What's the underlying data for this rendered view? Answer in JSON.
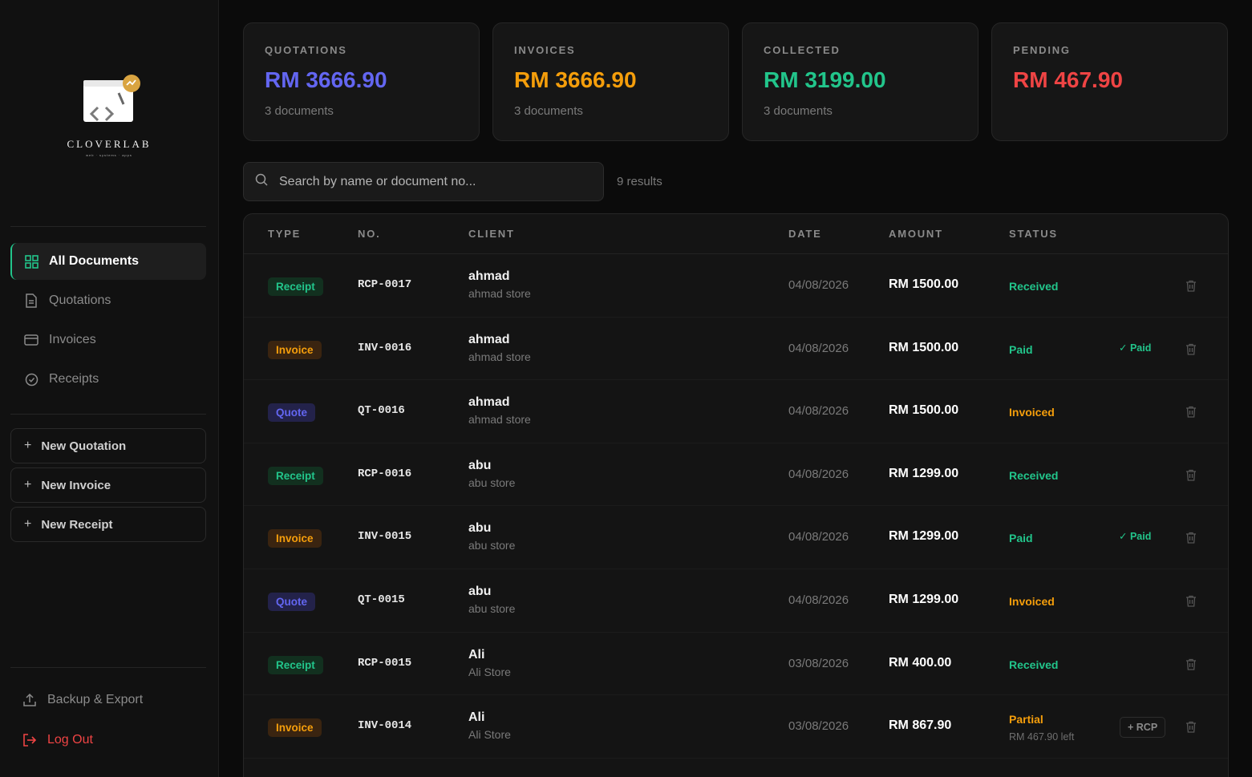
{
  "brand": {
    "name": "CLOVERLAB",
    "tagline": "web · systems · apps"
  },
  "nav": [
    {
      "label": "All Documents",
      "icon": "grid-icon",
      "active": true
    },
    {
      "label": "Quotations",
      "icon": "document-icon",
      "active": false
    },
    {
      "label": "Invoices",
      "icon": "card-icon",
      "active": false
    },
    {
      "label": "Receipts",
      "icon": "check-circle-icon",
      "active": false
    }
  ],
  "new_buttons": [
    {
      "label": "New Quotation"
    },
    {
      "label": "New Invoice"
    },
    {
      "label": "New Receipt"
    }
  ],
  "bottom": {
    "backup": "Backup & Export",
    "logout": "Log Out"
  },
  "summary": [
    {
      "label": "QUOTATIONS",
      "value": "RM 3666.90",
      "sub": "3 documents",
      "color": "#6366f1"
    },
    {
      "label": "INVOICES",
      "value": "RM 3666.90",
      "sub": "3 documents",
      "color": "#f59e0b"
    },
    {
      "label": "COLLECTED",
      "value": "RM 3199.00",
      "sub": "3 documents",
      "color": "#22c58b"
    },
    {
      "label": "PENDING",
      "value": "RM 467.90",
      "sub": "",
      "color": "#ef4444"
    }
  ],
  "search": {
    "placeholder": "Search by name or document no...",
    "results": "9 results"
  },
  "table": {
    "headers": {
      "type": "TYPE",
      "no": "NO.",
      "client": "CLIENT",
      "date": "DATE",
      "amount": "AMOUNT",
      "status": "STATUS"
    },
    "rows": [
      {
        "type": "Receipt",
        "kind": "receipt",
        "no": "RCP-0017",
        "client": "ahmad",
        "store": "ahmad store",
        "date": "04/08/2026",
        "amount": "RM 1500.00",
        "status": "Received",
        "status_kind": "received",
        "extra": "",
        "extra_kind": "",
        "remaining": ""
      },
      {
        "type": "Invoice",
        "kind": "invoice",
        "no": "INV-0016",
        "client": "ahmad",
        "store": "ahmad store",
        "date": "04/08/2026",
        "amount": "RM 1500.00",
        "status": "Paid",
        "status_kind": "paid",
        "extra": "✓ Paid",
        "extra_kind": "paid",
        "remaining": ""
      },
      {
        "type": "Quote",
        "kind": "quote",
        "no": "QT-0016",
        "client": "ahmad",
        "store": "ahmad store",
        "date": "04/08/2026",
        "amount": "RM 1500.00",
        "status": "Invoiced",
        "status_kind": "invoiced",
        "extra": "",
        "extra_kind": "",
        "remaining": ""
      },
      {
        "type": "Receipt",
        "kind": "receipt",
        "no": "RCP-0016",
        "client": "abu",
        "store": "abu store",
        "date": "04/08/2026",
        "amount": "RM 1299.00",
        "status": "Received",
        "status_kind": "received",
        "extra": "",
        "extra_kind": "",
        "remaining": ""
      },
      {
        "type": "Invoice",
        "kind": "invoice",
        "no": "INV-0015",
        "client": "abu",
        "store": "abu store",
        "date": "04/08/2026",
        "amount": "RM 1299.00",
        "status": "Paid",
        "status_kind": "paid",
        "extra": "✓ Paid",
        "extra_kind": "paid",
        "remaining": ""
      },
      {
        "type": "Quote",
        "kind": "quote",
        "no": "QT-0015",
        "client": "abu",
        "store": "abu store",
        "date": "04/08/2026",
        "amount": "RM 1299.00",
        "status": "Invoiced",
        "status_kind": "invoiced",
        "extra": "",
        "extra_kind": "",
        "remaining": ""
      },
      {
        "type": "Receipt",
        "kind": "receipt",
        "no": "RCP-0015",
        "client": "Ali",
        "store": "Ali Store",
        "date": "03/08/2026",
        "amount": "RM 400.00",
        "status": "Received",
        "status_kind": "received",
        "extra": "",
        "extra_kind": "",
        "remaining": ""
      },
      {
        "type": "Invoice",
        "kind": "invoice",
        "no": "INV-0014",
        "client": "Ali",
        "store": "Ali Store",
        "date": "03/08/2026",
        "amount": "RM 867.90",
        "status": "Partial",
        "status_kind": "partial",
        "extra": "+ RCP",
        "extra_kind": "rcp",
        "remaining": "RM 467.90 left"
      }
    ]
  }
}
